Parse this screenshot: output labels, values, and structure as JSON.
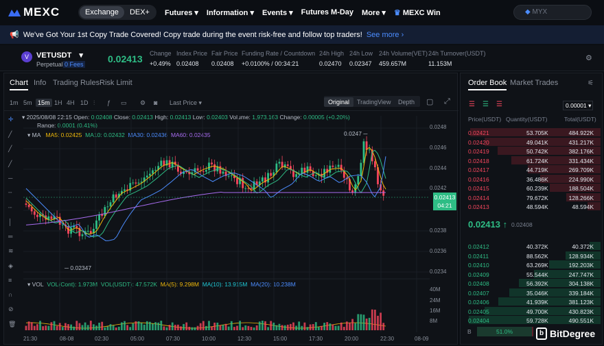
{
  "nav": {
    "brand": "MEXC",
    "exchange": "Exchange",
    "dex": "DEX+",
    "items": [
      "Futures",
      "Information",
      "Events",
      "Futures M-Day",
      "More"
    ],
    "win": "MEXC Win",
    "search_placeholder": "MYX"
  },
  "banner": {
    "text": "We've Got Your 1st Copy Trade Covered! Copy trade during the event risk-free and follow top traders!",
    "more": "See more"
  },
  "ticker": {
    "pair": "VETUSDT",
    "type": "Perpetual",
    "fees": "0 Fees",
    "last": "0.02413",
    "stats": [
      {
        "label": "Change",
        "value": "+0.49%"
      },
      {
        "label": "Index Price",
        "value": "0.02408"
      },
      {
        "label": "Fair Price",
        "value": "0.02408"
      },
      {
        "label": "Funding Rate / Countdown",
        "value": "+0.0100% / 00:34:21"
      },
      {
        "label": "24h High",
        "value": "0.02470"
      },
      {
        "label": "24h Low",
        "value": "0.02347"
      },
      {
        "label": "24h Volume(VET)",
        "value": "459.657M"
      },
      {
        "label": "24h Turnover(USDT)",
        "value": "11.153M"
      }
    ]
  },
  "chart": {
    "tabs": [
      "Chart",
      "Info",
      "Trading Rules",
      "Risk Limit"
    ],
    "timeframes": [
      "1m",
      "5m",
      "15m",
      "1H",
      "4H",
      "1D"
    ],
    "active_tf": "15m",
    "last_price_label": "Last Price",
    "views": [
      "Original",
      "TradingView",
      "Depth"
    ],
    "ohlc": {
      "date": "2025/08/08 22:15",
      "open_l": "Open:",
      "open": "0.02408",
      "close_l": "Close:",
      "close": "0.02413",
      "high_l": "High:",
      "high": "0.02413",
      "low_l": "Low:",
      "low": "0.02403",
      "vol_l": "Volume:",
      "vol": "1,973.163",
      "chg_l": "Change:",
      "chg": "0.00005 (+0.20%)",
      "range_l": "Range:",
      "range": "0.0001 (0.41%)"
    },
    "ma": {
      "label": "MA",
      "ma5": "MA5: 0.02425",
      "ma10": "MA10: 0.02432",
      "ma30": "MA30: 0.02436",
      "ma60": "MA60: 0.02435"
    },
    "vol": {
      "label": "VOL",
      "cont": "VOL(Cont): 1.973M",
      "usdt": "VOL(USDT): 47.572K",
      "ma5": "MA(5): 9.298M",
      "ma10": "MA(10): 13.915M",
      "ma20": "MA(20): 10.238M"
    },
    "high_mark": "0.0247",
    "low_mark": "0.02347",
    "price_tag": "0.02413",
    "countdown": "04:21",
    "yticks": [
      "0.0248",
      "0.0246",
      "0.0244",
      "0.0242",
      "0.0238",
      "0.0236",
      "0.0234"
    ],
    "vticks": [
      "40M",
      "24M",
      "16M",
      "8M"
    ],
    "xticks": [
      "21:30",
      "08-08",
      "02:30",
      "05:00",
      "07:30",
      "10:00",
      "12:30",
      "15:00",
      "17:30",
      "20:00",
      "22:30",
      "08-09"
    ]
  },
  "orderbook": {
    "tab": "Order Book",
    "tab2": "Market Trades",
    "precision": "0.00001",
    "h_price": "Price(USDT)",
    "h_qty": "Quantity(USDT)",
    "h_total": "Total(USDT)",
    "asks": [
      [
        "0.02421",
        "53.705K",
        "484.922K"
      ],
      [
        "0.02420",
        "49.041K",
        "431.217K"
      ],
      [
        "0.02419",
        "50.742K",
        "382.176K"
      ],
      [
        "0.02418",
        "61.724K",
        "331.434K"
      ],
      [
        "0.02417",
        "44.719K",
        "269.709K"
      ],
      [
        "0.02416",
        "36.486K",
        "224.990K"
      ],
      [
        "0.02415",
        "60.239K",
        "188.504K"
      ],
      [
        "0.02414",
        "79.672K",
        "128.266K"
      ],
      [
        "0.02413",
        "48.594K",
        "48.594K"
      ]
    ],
    "mid": "0.02413 ↑",
    "mid_sub": "0.02408",
    "bids": [
      [
        "0.02412",
        "40.372K",
        "40.372K"
      ],
      [
        "0.02411",
        "88.562K",
        "128.934K"
      ],
      [
        "0.02410",
        "63.269K",
        "192.203K"
      ],
      [
        "0.02409",
        "55.544K",
        "247.747K"
      ],
      [
        "0.02408",
        "56.392K",
        "304.138K"
      ],
      [
        "0.02407",
        "35.046K",
        "339.184K"
      ],
      [
        "0.02406",
        "41.939K",
        "381.123K"
      ],
      [
        "0.02405",
        "49.700K",
        "430.823K"
      ],
      [
        "0.02404",
        "59.728K",
        "490.551K"
      ]
    ],
    "b_label": "B",
    "b_pct": "51.0%"
  },
  "watermark": "BitDegree"
}
